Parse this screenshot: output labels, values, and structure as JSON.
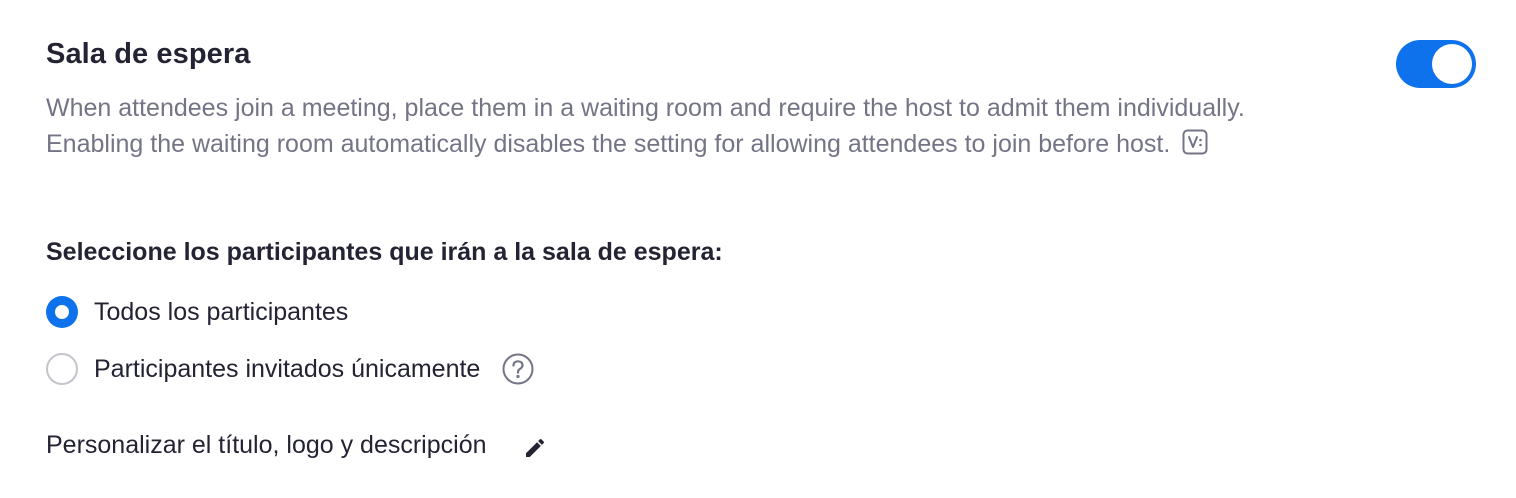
{
  "setting": {
    "title": "Sala de espera",
    "enabled": true,
    "description": "When attendees join a meeting, place them in a waiting room and require the host to admit them individually. Enabling the waiting room automatically disables the setting for allowing attendees to join before host.",
    "description_icon": "video-badge-icon",
    "subheading": "Seleccione los participantes que irán a la sala de espera:",
    "options": [
      {
        "label": "Todos los participantes",
        "selected": true
      },
      {
        "label": "Participantes invitados únicamente",
        "selected": false,
        "help_icon": "question-circle-icon"
      }
    ],
    "customize_label": "Personalizar el título, logo y descripción",
    "customize_icon": "pencil-icon"
  },
  "colors": {
    "accent": "#0e72ed",
    "text_primary": "#232333",
    "text_secondary": "#747487",
    "radio_border": "#c4c4cc"
  }
}
